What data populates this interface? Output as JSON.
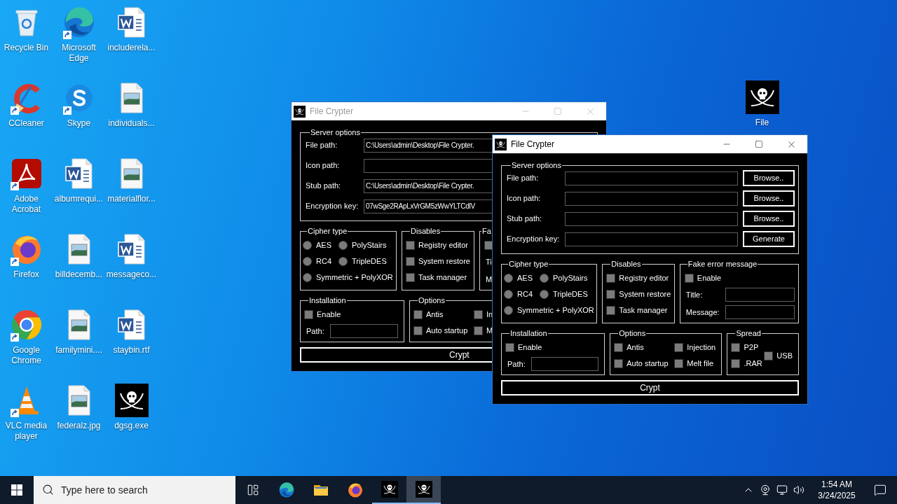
{
  "desktop": {
    "icons": [
      {
        "label": "Recycle Bin",
        "kind": "recycle",
        "shortcut": false
      },
      {
        "label": "CCleaner",
        "kind": "ccleaner",
        "shortcut": true
      },
      {
        "label": "Adobe Acrobat",
        "kind": "acrobat",
        "shortcut": true
      },
      {
        "label": "Firefox",
        "kind": "firefox",
        "shortcut": true
      },
      {
        "label": "Google Chrome",
        "kind": "chrome",
        "shortcut": true
      },
      {
        "label": "VLC media player",
        "kind": "vlc",
        "shortcut": true
      },
      {
        "label": "Microsoft Edge",
        "kind": "edge",
        "shortcut": true
      },
      {
        "label": "Skype",
        "kind": "skype",
        "shortcut": true
      },
      {
        "label": "albumrequi...",
        "kind": "word",
        "shortcut": false
      },
      {
        "label": "billdecemb...",
        "kind": "image",
        "shortcut": false
      },
      {
        "label": "familymini....",
        "kind": "image",
        "shortcut": false
      },
      {
        "label": "federalz.jpg",
        "kind": "image",
        "shortcut": false
      },
      {
        "label": "includerela...",
        "kind": "word",
        "shortcut": false
      },
      {
        "label": "individuals...",
        "kind": "image",
        "shortcut": false
      },
      {
        "label": "materialflor...",
        "kind": "image",
        "shortcut": false
      },
      {
        "label": "messageco...",
        "kind": "word",
        "shortcut": false
      },
      {
        "label": "staybin.rtf",
        "kind": "word",
        "shortcut": false
      },
      {
        "label": "dgsg.exe",
        "kind": "pirate",
        "shortcut": false
      }
    ],
    "free_icon": {
      "label": "File",
      "kind": "pirate",
      "shortcut": false
    }
  },
  "windows": [
    {
      "title": "File Crypter",
      "active": false,
      "server_options": {
        "label": "Server options",
        "rows": [
          {
            "label": "File path:",
            "value": "C:\\Users\\admin\\Desktop\\File Crypter."
          },
          {
            "label": "Icon path:"
          },
          {
            "label": "Stub path:",
            "value": "C:\\Users\\admin\\Desktop\\File Crypter."
          },
          {
            "label": "Encryption key:",
            "value": "07wSge2RApLxVrGM5zWwYLTCdlV"
          }
        ]
      },
      "cipher": {
        "label": "Cipher type",
        "options": [
          {
            "label": "AES",
            "selected": false
          },
          {
            "label": "PolyStairs",
            "selected": false
          },
          {
            "label": "RC4",
            "selected": false
          },
          {
            "label": "TripleDES",
            "selected": false
          },
          {
            "label": "Symmetric + PolyXOR",
            "selected": false
          }
        ]
      },
      "disables": {
        "label": "Disables",
        "items": [
          {
            "label": "Registry editor",
            "checked": false
          },
          {
            "label": "System restore",
            "checked": false
          },
          {
            "label": "Task manager",
            "checked": false
          }
        ]
      },
      "fake_error": {
        "label": "Fa",
        "enable": {
          "checked": false
        },
        "title_label": "Ti",
        "message_label": "M"
      },
      "installation": {
        "label": "Installation",
        "enable": {
          "label": "Enable",
          "checked": false
        },
        "path_label": "Path:"
      },
      "options": {
        "label": "Options",
        "items": [
          {
            "label": "Antis",
            "checked": false
          },
          {
            "label": "In",
            "checked": false
          },
          {
            "label": "Auto startup",
            "checked": false
          },
          {
            "label": "M",
            "checked": false
          }
        ]
      },
      "crypt_button": "Crypt"
    },
    {
      "title": "File Crypter",
      "active": true,
      "server_options": {
        "label": "Server options",
        "rows": [
          {
            "label": "File path:",
            "button": "Browse.."
          },
          {
            "label": "Icon path:",
            "button": "Browse.."
          },
          {
            "label": "Stub path:",
            "button": "Browse.."
          },
          {
            "label": "Encryption key:",
            "button": "Generate"
          }
        ]
      },
      "cipher": {
        "label": "Cipher type",
        "options": [
          {
            "label": "AES",
            "selected": false
          },
          {
            "label": "PolyStairs",
            "selected": false
          },
          {
            "label": "RC4",
            "selected": false
          },
          {
            "label": "TripleDES",
            "selected": false
          },
          {
            "label": "Symmetric + PolyXOR",
            "selected": false
          }
        ]
      },
      "disables": {
        "label": "Disables",
        "items": [
          {
            "label": "Registry editor",
            "checked": false
          },
          {
            "label": "System restore",
            "checked": false
          },
          {
            "label": "Task manager",
            "checked": false
          }
        ]
      },
      "fake_error": {
        "label": "Fake error message",
        "enable": {
          "label": "Enable",
          "checked": false
        },
        "title_label": "Title:",
        "message_label": "Message:"
      },
      "installation": {
        "label": "Installation",
        "enable": {
          "label": "Enable",
          "checked": false
        },
        "path_label": "Path:"
      },
      "options": {
        "label": "Options",
        "items": [
          {
            "label": "Antis",
            "checked": false
          },
          {
            "label": "Injection",
            "checked": false
          },
          {
            "label": "Auto startup",
            "checked": false
          },
          {
            "label": "Melt file",
            "checked": false
          }
        ]
      },
      "spread": {
        "label": "Spread",
        "items": [
          {
            "label": "P2P",
            "checked": false
          },
          {
            "label": ".RAR",
            "checked": false
          },
          {
            "label": "USB",
            "checked": false
          }
        ]
      },
      "crypt_button": "Crypt"
    }
  ],
  "taskbar": {
    "search_placeholder": "Type here to search",
    "apps": [
      {
        "kind": "edge",
        "running": false,
        "active": false
      },
      {
        "kind": "folder",
        "running": false,
        "active": false
      },
      {
        "kind": "firefox",
        "running": false,
        "active": false
      },
      {
        "kind": "pirate",
        "running": true,
        "active": false
      },
      {
        "kind": "pirate",
        "running": true,
        "active": true
      }
    ],
    "time": "1:54 AM",
    "date": "3/24/2025"
  }
}
